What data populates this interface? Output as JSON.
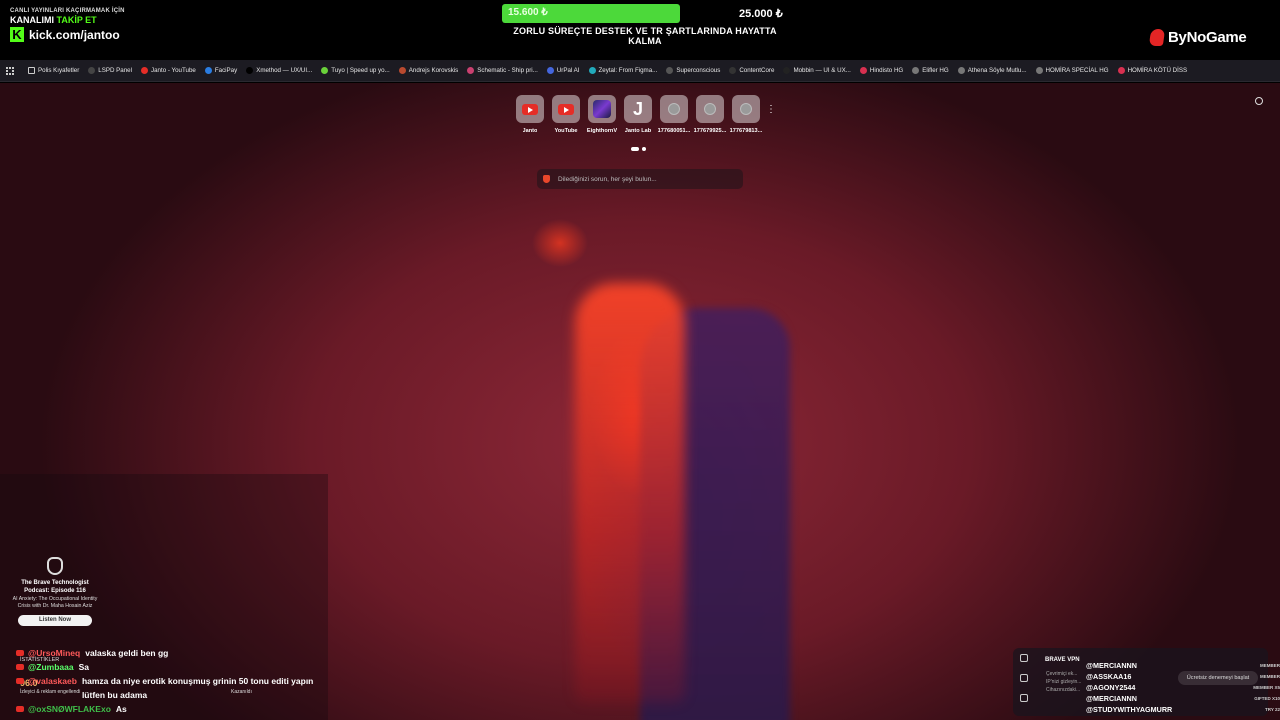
{
  "overlay": {
    "kick_line1": "CANLI YAYINLARI KAÇIRMAMAK İÇİN",
    "kick_line2_a": "KANALIMI ",
    "kick_line2_b": "TAKİP ET",
    "kick_logo": "K",
    "kick_url": "kick.com/jantoo",
    "donation_current": "15.600 ₺",
    "donation_goal": "25.000 ₺",
    "donation_progress": 0.624,
    "donation_caption": "ZORLU SÜREÇTE DESTEK VE TR ŞARTLARINDA HAYATTA KALMA",
    "sponsor": "ByNoGame"
  },
  "bookmarks": [
    {
      "label": "Polis Kıyafetler",
      "icon": "folder-icon",
      "color": "#888888"
    },
    {
      "label": "LSPD Panel",
      "icon": "app-icon",
      "color": "#444444"
    },
    {
      "label": "Janto - YouTube",
      "icon": "youtube-icon",
      "color": "#e52d27"
    },
    {
      "label": "FaciPay",
      "icon": "app-icon",
      "color": "#2a7de1"
    },
    {
      "label": "Xmethod — UX/UI...",
      "icon": "x-icon",
      "color": "#000000"
    },
    {
      "label": "Tuyo | Speed up yo...",
      "icon": "app-icon",
      "color": "#6ad13a"
    },
    {
      "label": "Andrejs Korovskis",
      "icon": "app-icon",
      "color": "#b94a2f"
    },
    {
      "label": "Schematic - Ship pri...",
      "icon": "app-icon",
      "color": "#c94070"
    },
    {
      "label": "UrPal AI",
      "icon": "app-icon",
      "color": "#4466dd"
    },
    {
      "label": "Zeytal: From Figma...",
      "icon": "app-icon",
      "color": "#22aabb"
    },
    {
      "label": "Superconscious",
      "icon": "app-icon",
      "color": "#555555"
    },
    {
      "label": "ContentCore",
      "icon": "app-icon",
      "color": "#333333"
    },
    {
      "label": "Mobbin — UI & UX...",
      "icon": "app-icon",
      "color": "#222222"
    },
    {
      "label": "Hindisto HG",
      "icon": "app-icon",
      "color": "#d83050"
    },
    {
      "label": "Elifler HG",
      "icon": "app-icon",
      "color": "#777777"
    },
    {
      "label": "Athena Söyle Mutlu...",
      "icon": "app-icon",
      "color": "#777777"
    },
    {
      "label": "HOMİRA SPECİAL HG",
      "icon": "app-icon",
      "color": "#777777"
    },
    {
      "label": "HOMİRA KÖTÜ DİSS",
      "icon": "app-icon",
      "color": "#d83050"
    }
  ],
  "shortcuts": [
    {
      "label": "Janto",
      "type": "youtube"
    },
    {
      "label": "YouTube",
      "type": "youtube"
    },
    {
      "label": "EighthornV",
      "type": "image"
    },
    {
      "label": "Janto Lab",
      "type": "letter",
      "letter": "J"
    },
    {
      "label": "177680051...",
      "type": "globe"
    },
    {
      "label": "177679925...",
      "type": "globe"
    },
    {
      "label": "177679813...",
      "type": "globe"
    }
  ],
  "search": {
    "placeholder": "Dilediğinizi sorun, her şeyi bulun..."
  },
  "promo": {
    "title": "The Brave Technologist Podcast: Episode 116",
    "subtitle": "AI Anxiety: The Occupational Identity Crisis with Dr. Maha Hosain Aziz",
    "button": "Listen Now"
  },
  "stats": {
    "label": "İSTATİSTİKLER",
    "value": "96.0",
    "sub": "İzleyici & reklam engellendi",
    "sub2": "Kazanıldı"
  },
  "chat": [
    {
      "user": "@UrsoMineq",
      "color": "#ff5a5a",
      "message": "valaska geldi ben gg"
    },
    {
      "user": "@Zumbaaa",
      "color": "#5aff6a",
      "message": "Sa"
    },
    {
      "user": "@valaskaeb",
      "color": "#ff5a5a",
      "message": "hamza da niye erotik konuşmuş grinin 50 tonu editi yapın lütfen bu adama"
    },
    {
      "user": "@oxSNØWFLAKExo",
      "color": "#3fbf4a",
      "message": "As"
    }
  ],
  "vpn": {
    "title": "BRAVE VPN",
    "line1": "Çevrimiçi ek...",
    "line2": "IP'nizi gizleyin...",
    "line3": "Cihazınızdaki...",
    "button": "Ücretsiz denemeyi başlat"
  },
  "members": [
    {
      "name": "@MERCIANNN",
      "tag": "MEMBER"
    },
    {
      "name": "@ASSKAA16",
      "tag": "MEMBER"
    },
    {
      "name": "@AGONY2544",
      "tag": "MEMBER X5"
    },
    {
      "name": "@MERCIANNN",
      "tag": "GIFTED X10"
    },
    {
      "name": "@STUDYWITHYAGMURR",
      "tag": "TRY 22"
    }
  ]
}
